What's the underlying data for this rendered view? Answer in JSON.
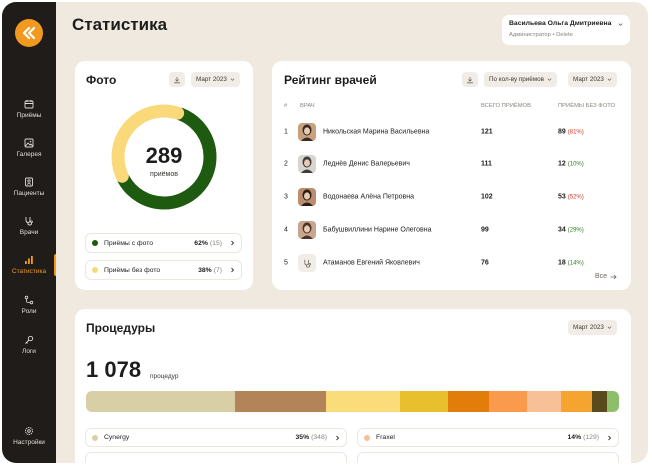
{
  "sidebar": {
    "items": [
      {
        "label": "Приёмы",
        "icon": "calendar-icon"
      },
      {
        "label": "Галерея",
        "icon": "image-icon"
      },
      {
        "label": "Пациенты",
        "icon": "contacts-icon"
      },
      {
        "label": "Врачи",
        "icon": "stethoscope-icon"
      },
      {
        "label": "Статистика",
        "icon": "bar-chart-icon",
        "active": true
      },
      {
        "label": "Роли",
        "icon": "network-icon"
      },
      {
        "label": "Логи",
        "icon": "key-icon"
      }
    ],
    "settings_label": "Настройки"
  },
  "page_title": "Статистика",
  "user": {
    "name": "Васильева Ольга Дмитриевна",
    "role": "Администратор",
    "separator": "•",
    "delete_label": "Delete"
  },
  "photo": {
    "title": "Фото",
    "period": "Март 2023",
    "total": "289",
    "total_label": "приёмов",
    "legend": [
      {
        "label": "Приёмы с фото",
        "pct": "62%",
        "count": "(15)",
        "color": "#1e5a0f",
        "fraction": 0.62
      },
      {
        "label": "Приёмы без фото",
        "pct": "38%",
        "count": "(7)",
        "color": "#fad97a",
        "fraction": 0.38
      }
    ]
  },
  "rating": {
    "title": "Рейтинг врачей",
    "sort_label": "По кол-ву приёмов",
    "period": "Март 2023",
    "headers": {
      "rank": "#",
      "doctor": "Врач",
      "total": "Всего приёмов",
      "without": "Приёмы без фото"
    },
    "doctors": [
      {
        "rank": "1",
        "name": "Никольская Марина Васильевна",
        "total": "121",
        "without": "89",
        "without_pct": "(81%)",
        "pct_color": "#d23b2a",
        "avatar": "photo"
      },
      {
        "rank": "2",
        "name": "Леднёв Денис Валерьевич",
        "total": "111",
        "without": "12",
        "without_pct": "(10%)",
        "pct_color": "#2f7d1d",
        "avatar": "photo"
      },
      {
        "rank": "3",
        "name": "Водонаева Алёна Петровна",
        "total": "102",
        "without": "53",
        "without_pct": "(52%)",
        "pct_color": "#d23b2a",
        "avatar": "photo"
      },
      {
        "rank": "4",
        "name": "Бабушвиллини Нарине Олеговна",
        "total": "99",
        "without": "34",
        "without_pct": "(29%)",
        "pct_color": "#2f7d1d",
        "avatar": "photo"
      },
      {
        "rank": "5",
        "name": "Атаманов Евгений Яковлевич",
        "total": "76",
        "without": "18",
        "without_pct": "(14%)",
        "pct_color": "#2f7d1d",
        "avatar": "placeholder"
      }
    ],
    "see_all": "Все"
  },
  "procedures": {
    "title": "Процедуры",
    "period": "Март 2023",
    "total": "1 078",
    "unit": "процедур",
    "segments": [
      {
        "color": "#d9cfa7",
        "share": 0.28
      },
      {
        "color": "#b38457",
        "share": 0.17
      },
      {
        "color": "#fbdc7b",
        "share": 0.14
      },
      {
        "color": "#e8bf2d",
        "share": 0.09
      },
      {
        "color": "#e27d0b",
        "share": 0.076
      },
      {
        "color": "#f99a4c",
        "share": 0.073
      },
      {
        "color": "#f7c096",
        "share": 0.063
      },
      {
        "color": "#f4a42f",
        "share": 0.058
      },
      {
        "color": "#5a4b1c",
        "share": 0.028
      },
      {
        "color": "#8dbf6b",
        "share": 0.023
      }
    ],
    "legend": [
      {
        "label": "Cynergy",
        "pct": "35%",
        "count": "(348)",
        "color": "#d9cfa7"
      },
      {
        "label": "Fraxel",
        "pct": "14%",
        "count": "(129)",
        "color": "#f7c096"
      }
    ]
  }
}
